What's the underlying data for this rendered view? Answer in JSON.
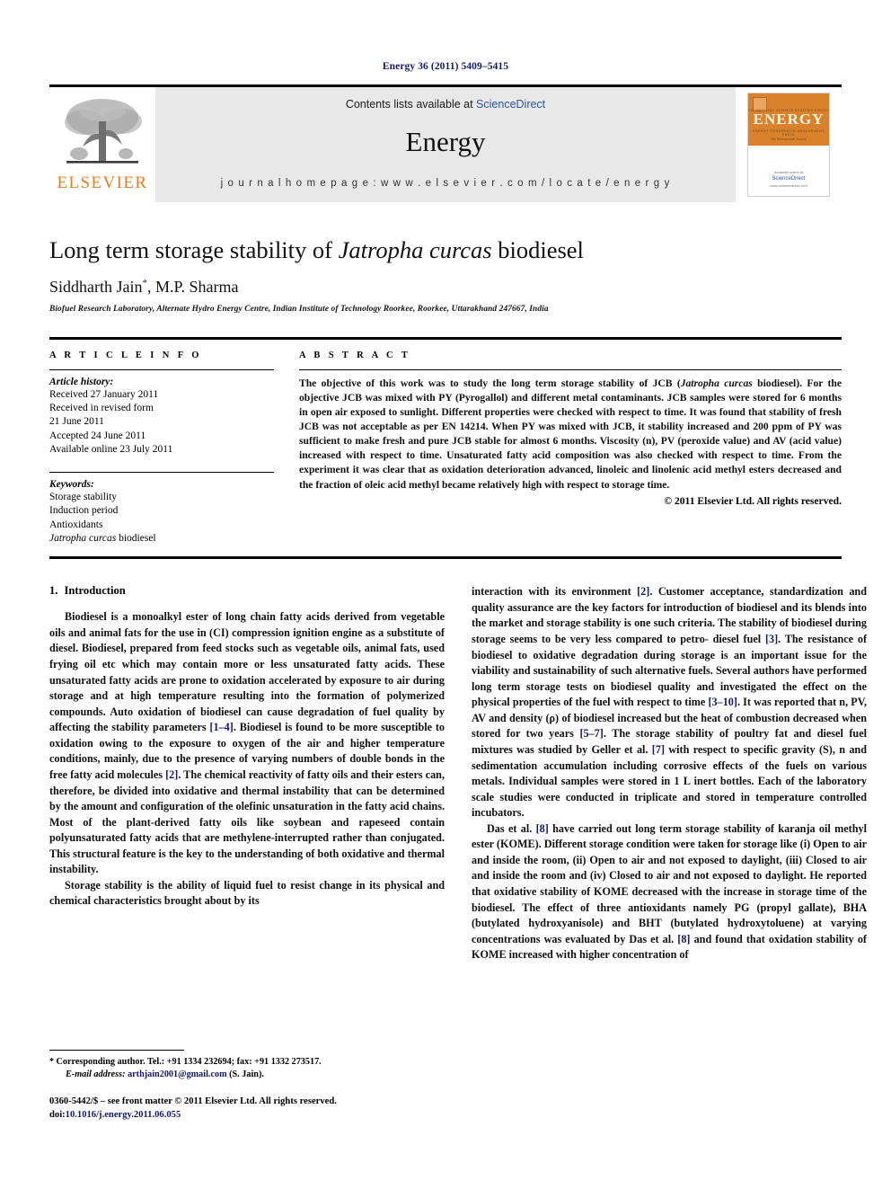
{
  "running_head": "Energy 36 (2011) 5409–5415",
  "masthead": {
    "logo_word": "ELSEVIER",
    "contents_prefix": "Contents lists available at ",
    "contents_link": "ScienceDirect",
    "journal_title": "Energy",
    "homepage": "j o u r n a l   h o m e p a g e :   w w w . e l s e v i e r . c o m / l o c a t e / e n e r g y",
    "cover": {
      "band_word": "ENERGY",
      "subtitle": "The International Journal",
      "top_labels": "TECHNOLOGY      SCIENCE      SYSTEMS      POLICY",
      "bottom_labels": "ENERGY      CONVERSION      MANAGEMENT      FUELS",
      "footer_line1": "Available online at",
      "footer_logo": "ScienceDirect",
      "footer_line2": "www.sciencedirect.com"
    }
  },
  "article": {
    "title_pre": "Long term storage stability of ",
    "title_italic": "Jatropha curcas",
    "title_post": " biodiesel",
    "authors_pre": "Siddharth Jain",
    "author_star": "*",
    "authors_post": ", M.P. Sharma",
    "affiliation": "Biofuel Research Laboratory, Alternate Hydro Energy Centre, Indian Institute of Technology Roorkee, Roorkee, Uttarakhand 247667, India"
  },
  "info": {
    "section_label": "A R T I C L E   I N F O",
    "history_title": "Article history:",
    "history": [
      "Received 27 January 2011",
      "Received in revised form",
      "21 June 2011",
      "Accepted 24 June 2011",
      "Available online 23 July 2011"
    ],
    "keywords_title": "Keywords:",
    "keywords": [
      "Storage stability",
      "Induction period",
      "Antioxidants"
    ],
    "keyword_italic_pre": "Jatropha curcas",
    "keyword_italic_post": " biodiesel"
  },
  "abstract": {
    "section_label": "A B S T R A C T",
    "paragraph_1": "The objective of this work was to study the long term storage stability of JCB (",
    "paragraph_1_italic": "Jatropha curcas",
    "paragraph_1_rest": " biodiesel). For the objective JCB was mixed with PY (Pyrogallol) and different metal contaminants. JCB samples were stored for 6 months in open air exposed to sunlight. Different properties were checked with respect to time. It was found that stability of fresh JCB was not acceptable as per EN 14214. When PY was mixed with JCB, it stability increased and 200 ppm of PY was sufficient to make fresh and pure JCB stable for almost 6 months. Viscosity (n), PV (peroxide value) and AV (acid value) increased with respect to time. Unsaturated fatty acid composition was also checked with respect to time. From the experiment it was clear that as oxidation deterioration advanced, linoleic and linolenic acid methyl esters decreased and the fraction of oleic acid methyl became relatively high with respect to storage time.",
    "copyright": "© 2011 Elsevier Ltd. All rights reserved."
  },
  "body": {
    "section_number": "1.",
    "section_title": "Introduction",
    "left_paragraph_1_a": "Biodiesel is a monoalkyl ester of long chain fatty acids derived from vegetable oils and animal fats for the use in (CI) compression ignition engine as a substitute of diesel. Biodiesel, prepared from feed stocks such as vegetable oils, animal fats, used frying oil etc which may contain more or less unsaturated fatty acids. These unsaturated fatty acids are prone to oxidation accelerated by exposure to air during storage and at high temperature resulting into the formation of polymerized compounds. Auto oxidation of biodiesel can cause degradation of fuel quality by affecting the stability parameters ",
    "left_cite_1": "[1–4]",
    "left_paragraph_1_b": ". Biodiesel is found to be more susceptible to oxidation owing to the exposure to oxygen of the air and higher temperature conditions, mainly, due to the presence of varying numbers of double bonds in the free fatty acid molecules ",
    "left_cite_2": "[2]",
    "left_paragraph_1_c": ". The chemical reactivity of fatty oils and their esters can, therefore, be divided into oxidative and thermal instability that can be determined by the amount and configuration of the olefinic unsaturation in the fatty acid chains. Most of the plant-derived fatty oils like soybean and rapeseed contain polyunsaturated fatty acids that are methylene-interrupted rather than conjugated. This structural feature is the key to the understanding of both oxidative and thermal instability.",
    "left_paragraph_2": "Storage stability is the ability of liquid fuel to resist change in its physical and chemical characteristics brought about by its",
    "right_paragraph_1_a": "interaction with its environment ",
    "right_cite_1": "[2]",
    "right_paragraph_1_b": ". Customer acceptance, standardization and quality assurance are the key factors for introduction of biodiesel and its blends into the market and storage stability is one such criteria. The stability of biodiesel during storage seems to be very less compared to petro- diesel fuel ",
    "right_cite_2": "[3]",
    "right_paragraph_1_c": ". The resistance of biodiesel to oxidative degradation during storage is an important issue for the viability and sustainability of such alternative fuels. Several authors have performed long term storage tests on biodiesel quality and investigated the effect on the physical properties of the fuel with respect to time ",
    "right_cite_3": "[3–10]",
    "right_paragraph_1_d": ". It was reported that n, PV, AV and density (ρ) of biodiesel increased but the heat of combustion decreased when stored for two years ",
    "right_cite_4": "[5–7]",
    "right_paragraph_1_e": ". The storage stability of poultry fat and diesel fuel mixtures was studied by Geller et al. ",
    "right_cite_5": "[7]",
    "right_paragraph_1_f": " with respect to specific gravity (S), n and sedimentation accumulation including corrosive effects of the fuels on various metals. Individual samples were stored in 1 L inert bottles. Each of the laboratory scale studies were conducted in triplicate and stored in temperature controlled incubators.",
    "right_paragraph_2_a": "Das et al. ",
    "right_cite_6": "[8]",
    "right_paragraph_2_b": " have carried out long term storage stability of karanja oil methyl ester (KOME). Different storage condition were taken for storage like (i) Open to air and inside the room, (ii) Open to air and not exposed to daylight, (iii) Closed to air and inside the room and (iv) Closed to air and not exposed to daylight. He reported that oxidative stability of KOME decreased with the increase in storage time of the biodiesel. The effect of three antioxidants namely PG (propyl gallate), BHA (butylated hydroxyanisole) and BHT (butylated hydroxytoluene) at varying concentrations was evaluated by Das et al. ",
    "right_cite_7": "[8]",
    "right_paragraph_2_c": " and found that oxidation stability of KOME increased with higher concentration of"
  },
  "footnotes": {
    "corresponding_star": "*",
    "corresponding": " Corresponding author. Tel.: +91 1334 232694; fax: +91 1332 273517.",
    "email_label": "E-mail address:",
    "email": "arthjain2001@gmail.com",
    "email_suffix": " (S. Jain).",
    "issn_line": "0360-5442/$ – see front matter © 2011 Elsevier Ltd. All rights reserved.",
    "doi_label": "doi:",
    "doi_value": "10.1016/j.energy.2011.06.055"
  }
}
